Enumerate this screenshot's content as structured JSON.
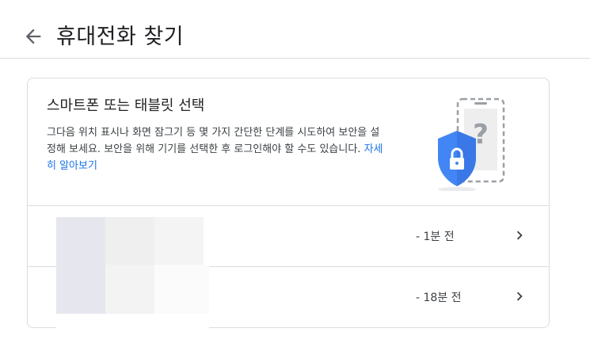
{
  "header": {
    "back_icon": "arrow-back-icon",
    "title": "휴대전화 찾기"
  },
  "card": {
    "title": "스마트폰 또는 태블릿 선택",
    "description": "그다음 위치 표시나 화면 잠그기 등 몇 가지 간단한 단계를 시도하여 보안을 설정해 보세요. 보안을 위해 기기를 선택한 후 로그인해야 할 수도 있습니다.",
    "learn_more": "자세히 알아보기",
    "illustration_icon": "phone-shield-lock-icon"
  },
  "devices": [
    {
      "time": "- 1분 전",
      "chevron_icon": "chevron-right-icon"
    },
    {
      "time": "- 18분 전",
      "chevron_icon": "chevron-right-icon"
    }
  ],
  "colors": {
    "accent": "#1a73e8",
    "shield": "#4285f4",
    "divider": "#dadce0"
  }
}
